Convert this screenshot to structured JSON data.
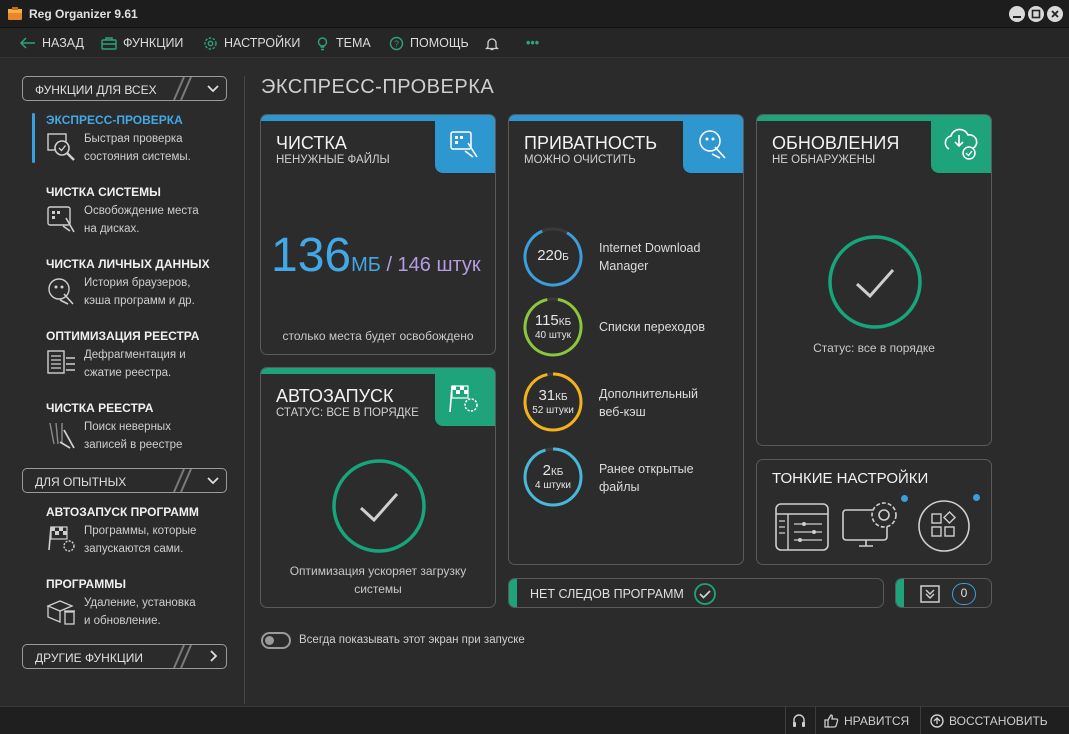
{
  "window": {
    "title": "Reg Organizer 9.61"
  },
  "menu": {
    "back": "НАЗАД",
    "functions": "ФУНКЦИИ",
    "settings": "НАСТРОЙКИ",
    "theme": "ТЕМА",
    "help": "ПОМОЩЬ",
    "more": "•••"
  },
  "sidebar": {
    "group1": "ФУНКЦИИ ДЛЯ ВСЕХ",
    "group2": "ДЛЯ ОПЫТНЫХ",
    "group3": "ДРУГИЕ ФУНКЦИИ",
    "items": [
      {
        "title": "ЭКСПРЕСС-ПРОВЕРКА",
        "desc1": "Быстрая проверка",
        "desc2": "состояния системы."
      },
      {
        "title": "ЧИСТКА СИСТЕМЫ",
        "desc1": "Освобождение места",
        "desc2": "на дисках."
      },
      {
        "title": "ЧИСТКА ЛИЧНЫХ ДАННЫХ",
        "desc1": "История браузеров,",
        "desc2": "кэша программ и др."
      },
      {
        "title": "ОПТИМИЗАЦИЯ РЕЕСТРА",
        "desc1": "Дефрагментация и",
        "desc2": "сжатие реестра."
      },
      {
        "title": "ЧИСТКА РЕЕСТРА",
        "desc1": "Поиск неверных",
        "desc2": "записей в реестре"
      },
      {
        "title": "АВТОЗАПУСК ПРОГРАММ",
        "desc1": "Программы, которые",
        "desc2": "запускаются сами."
      },
      {
        "title": "ПРОГРАММЫ",
        "desc1": "Удаление, установка",
        "desc2": "и обновление."
      }
    ]
  },
  "page": {
    "title": "ЭКСПРЕСС-ПРОВЕРКА"
  },
  "clean": {
    "title": "ЧИСТКА",
    "subtitle": "НЕНУЖНЫЕ ФАЙЛЫ",
    "number": "136",
    "unit": "МБ",
    "sep": " / 146 штук",
    "foot": "столько места будет освобождено"
  },
  "autorun": {
    "title": "АВТОЗАПУСК",
    "subtitle": "СТАТУС: ВСЕ В ПОРЯДКЕ",
    "foot1": "Оптимизация ускоряет загрузку",
    "foot2": "системы"
  },
  "privacy": {
    "title": "ПРИВАТНОСТЬ",
    "subtitle": "МОЖНО ОЧИСТИТЬ",
    "rows": [
      {
        "value": "220",
        "unit": "Б",
        "count": "",
        "label1": "Internet Download",
        "label2": "Manager",
        "color": "#3a9fdc"
      },
      {
        "value": "115",
        "unit": "КБ",
        "count": "40 штук",
        "label1": "Списки переходов",
        "label2": "",
        "color": "#8cc63f"
      },
      {
        "value": "31",
        "unit": "КБ",
        "count": "52 штуки",
        "label1": "Дополнительный",
        "label2": "веб-кэш",
        "color": "#f3b21b"
      },
      {
        "value": "2",
        "unit": "КБ",
        "count": "4 штуки",
        "label1": "Ранее открытые",
        "label2": "файлы",
        "color": "#48b7d8"
      }
    ]
  },
  "updates": {
    "title": "ОБНОВЛЕНИЯ",
    "subtitle": "НЕ ОБНАРУЖЕНЫ",
    "status": "Статус: все в порядке"
  },
  "tweaks": {
    "title": "ТОНКИЕ НАСТРОЙКИ"
  },
  "traces": {
    "label": "НЕТ СЛЕДОВ ПРОГРАММ"
  },
  "counter": {
    "value": "0"
  },
  "startup_toggle": {
    "label": "Всегда показывать этот экран при запуске"
  },
  "statusbar": {
    "like": "НРАВИТСЯ",
    "restore": "ВОССТАНОВИТЬ"
  },
  "colors": {
    "blue": "#2f97cf",
    "green": "#1fa37a",
    "ring_green": "#17a57c"
  }
}
